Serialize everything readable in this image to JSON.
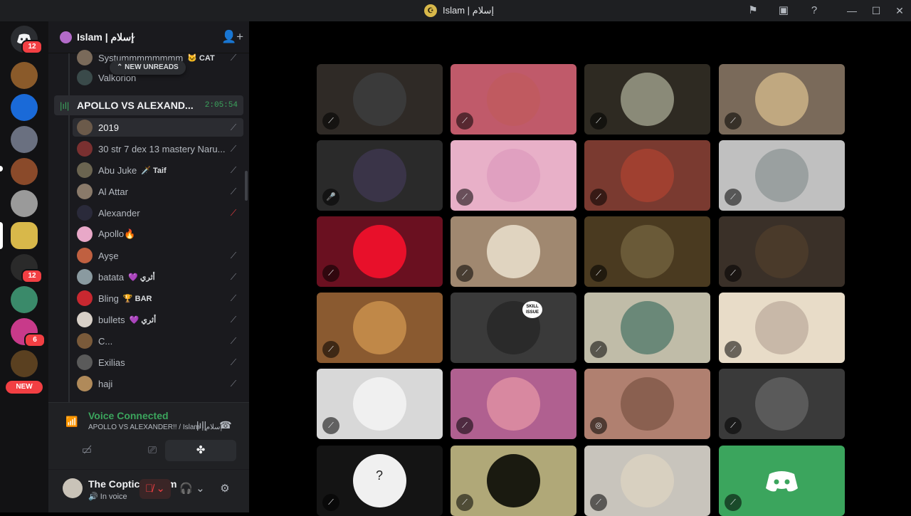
{
  "window": {
    "title": "Islam | إسلام"
  },
  "guilds": {
    "home_badge": "12",
    "badge2": "12",
    "badge3": "6",
    "new_label": "NEW"
  },
  "server": {
    "name": "Islam | إسلام"
  },
  "new_unreads": "NEW UNREADS",
  "members_top": [
    {
      "name": "Systummmmmmmm",
      "tag": "🐱 CAT"
    },
    {
      "name": "Valkorion",
      "tag": ""
    }
  ],
  "channel": {
    "name": "APOLLO VS ALEXAND...",
    "timer": "2:05:54"
  },
  "members": [
    {
      "name": "2019",
      "tag": "",
      "color": "#6b5a4a",
      "mic": "muted"
    },
    {
      "name": "30 str 7 dex 13 mastery Naru...",
      "tag": "",
      "color": "#7a3030",
      "mic": "muted"
    },
    {
      "name": "Abu Juke",
      "tag": "🗡️ Taif",
      "color": "#6b6450",
      "mic": "muted"
    },
    {
      "name": "Al Attar",
      "tag": "",
      "color": "#8a7a6a",
      "mic": "muted"
    },
    {
      "name": "Alexander",
      "tag": "",
      "color": "#2a2a3a",
      "mic": "server-muted"
    },
    {
      "name": "Apollo🔥",
      "tag": "",
      "color": "#e8a8c8",
      "mic": ""
    },
    {
      "name": "Ayşe",
      "tag": "",
      "color": "#c06040",
      "mic": "muted"
    },
    {
      "name": "batata",
      "tag": "💜 أثري",
      "color": "#8a9aa0",
      "mic": "muted"
    },
    {
      "name": "Bling",
      "tag": "🏆 BAR",
      "color": "#c82830",
      "mic": "muted"
    },
    {
      "name": "bullets",
      "tag": "💜 أثري",
      "color": "#d8d0c8",
      "mic": "muted"
    },
    {
      "name": "C...",
      "tag": "",
      "color": "#7a5a3a",
      "mic": "muted"
    },
    {
      "name": "Exilias",
      "tag": "",
      "color": "#5a5a5a",
      "mic": "muted"
    },
    {
      "name": "haji",
      "tag": "",
      "color": "#b08a5a",
      "mic": "muted"
    }
  ],
  "voice": {
    "status": "Voice Connected",
    "location": "APOLLO VS ALEXANDER!! / Islam | إسلام"
  },
  "user": {
    "name": "The Coptic Muslim",
    "status": "In voice"
  },
  "tiles": [
    {
      "bg": "#2f2a26",
      "av": "#3a3a3a",
      "icon": "muted"
    },
    {
      "bg": "#c05a6a",
      "av": "#c05a60",
      "icon": "muted"
    },
    {
      "bg": "#2e2a22",
      "av": "#8a8a78",
      "icon": "muted"
    },
    {
      "bg": "#7a6a5a",
      "av": "#c0a880",
      "icon": "muted"
    },
    {
      "bg": "#2a2a2a",
      "av": "#3a3448",
      "icon": "speaking"
    },
    {
      "bg": "#e8b0c8",
      "av": "#e0a0c0",
      "icon": "muted"
    },
    {
      "bg": "#7a3a30",
      "av": "#a04030",
      "icon": "muted"
    },
    {
      "bg": "#c0c0c0",
      "av": "#9aa0a0",
      "icon": "muted"
    },
    {
      "bg": "#6a1020",
      "av": "#e8102a",
      "icon": "muted"
    },
    {
      "bg": "#a08870",
      "av": "#e0d4c0",
      "icon": "muted"
    },
    {
      "bg": "#4a3a20",
      "av": "#6a5a38",
      "icon": "muted"
    },
    {
      "bg": "#3a3028",
      "av": "#4a3a2a",
      "icon": "muted"
    },
    {
      "bg": "#8a5a30",
      "av": "#c08848",
      "icon": "muted"
    },
    {
      "bg": "#3a3a3a",
      "av": "#2a2a2a",
      "icon": "none"
    },
    {
      "bg": "#c0bca8",
      "av": "#6a8878",
      "icon": "muted"
    },
    {
      "bg": "#e8dcc8",
      "av": "#c8b8a8",
      "icon": "muted"
    },
    {
      "bg": "#d8d8d8",
      "av": "#f0f0f0",
      "icon": "muted"
    },
    {
      "bg": "#b06090",
      "av": "#d888a0",
      "icon": "muted"
    },
    {
      "bg": "#b08070",
      "av": "#8a6050",
      "icon": "deafened"
    },
    {
      "bg": "#3a3a3a",
      "av": "#5a5a5a",
      "icon": "muted"
    },
    {
      "bg": "#141414",
      "av": "#f0f0f0",
      "icon": "muted"
    },
    {
      "bg": "#b0a878",
      "av": "#1a1a10",
      "icon": "muted"
    },
    {
      "bg": "#c8c4bc",
      "av": "#d8d0c0",
      "icon": "muted"
    },
    {
      "bg": "#3ba55d",
      "av": "#3ba55d",
      "icon": "muted"
    }
  ],
  "tile_labels": {
    "skill_issue": "SKILL ISSUE",
    "unknown": "?"
  },
  "colors": {
    "accent_green": "#3ba55d",
    "danger_red": "#f23f43",
    "blurple": "#5865f2"
  }
}
